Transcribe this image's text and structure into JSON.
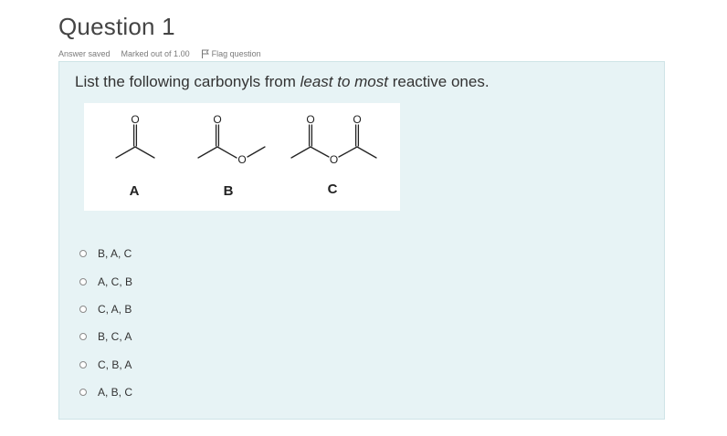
{
  "question": {
    "title": "Question 1",
    "status": "Answer saved",
    "marks": "Marked out of 1.00",
    "flag_label": "Flag question"
  },
  "prompt": {
    "before": "List the following carbonyls from ",
    "emphasis": "least to most",
    "after": " reactive ones."
  },
  "figure": {
    "labels": [
      "A",
      "B",
      "C"
    ],
    "atom_O": "O"
  },
  "options": [
    {
      "label": "B, A, C"
    },
    {
      "label": "A, C, B"
    },
    {
      "label": "C, A, B"
    },
    {
      "label": "B, C, A"
    },
    {
      "label": "C, B, A"
    },
    {
      "label": "A, B, C"
    }
  ]
}
